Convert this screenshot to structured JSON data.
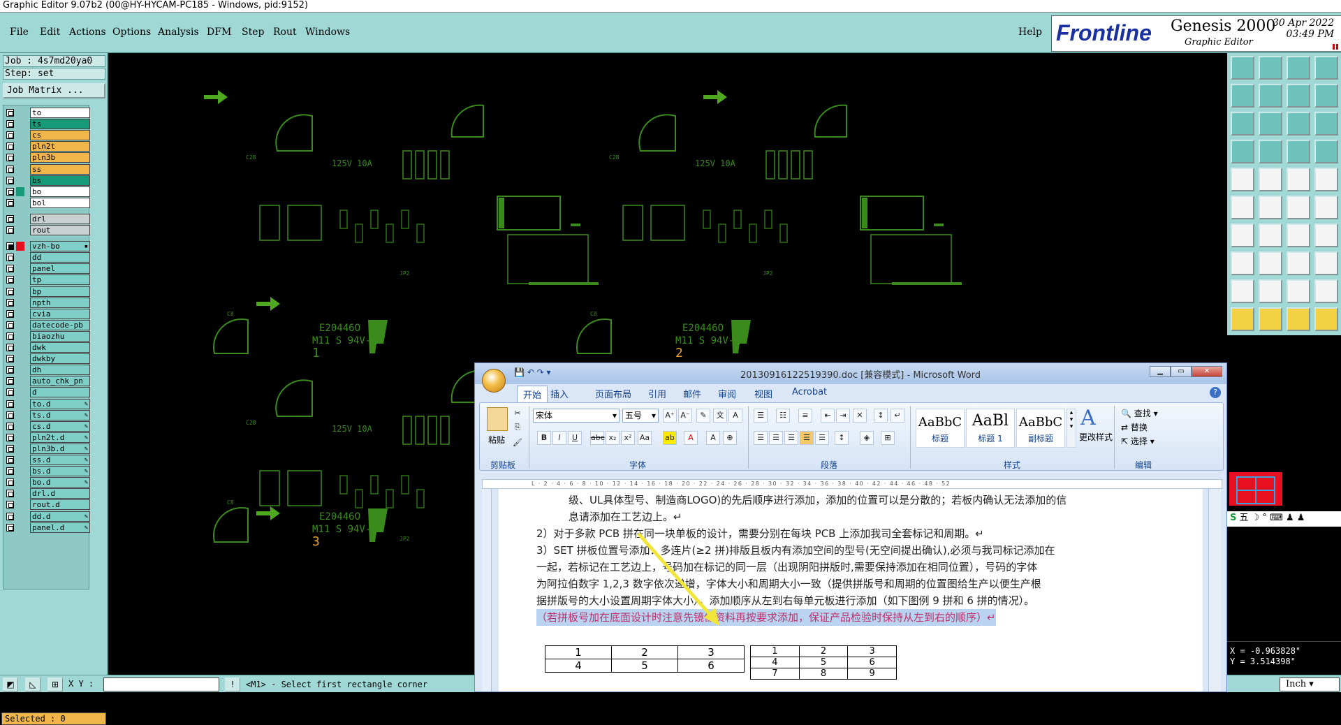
{
  "window": {
    "title": "Graphic Editor 9.07b2 (00@HY-HYCAM-PC185 - Windows, pid:9152)"
  },
  "menu": {
    "items": [
      "File",
      "Edit",
      "Actions",
      "Options",
      "Analysis",
      "DFM",
      "Step",
      "Rout",
      "Windows"
    ],
    "help": "Help"
  },
  "brand": {
    "logo": "Frontline",
    "product": "Genesis 2000",
    "subtitle": "Graphic Editor",
    "date": "30 Apr 2022",
    "time": "03:49 PM"
  },
  "job": {
    "job_label": "Job : 4s7md20ya0",
    "step_label": "Step: set",
    "matrix_button": "Job Matrix ..."
  },
  "layers": [
    {
      "name": "to",
      "color": "w",
      "sel": false
    },
    {
      "name": "ts",
      "color": "g",
      "sel": false
    },
    {
      "name": "cs",
      "color": "o",
      "sel": false
    },
    {
      "name": "pln2t",
      "color": "o",
      "sel": false
    },
    {
      "name": "pln3b",
      "color": "o",
      "sel": false
    },
    {
      "name": "ss",
      "color": "o",
      "sel": false
    },
    {
      "name": "bs",
      "color": "g",
      "sel": false
    },
    {
      "name": "bo",
      "color": "w",
      "sel": false,
      "aff": "#169a78"
    },
    {
      "name": "bol",
      "color": "w",
      "sel": false
    },
    {
      "name": "drl",
      "color": "gr",
      "sel": false
    },
    {
      "name": "rout",
      "color": "gr",
      "sel": false
    },
    {
      "name": "vzh-bo",
      "color": "c",
      "sel": true,
      "aff": "#e81020",
      "mark": "▪"
    },
    {
      "name": "dd",
      "color": "c",
      "sel": false
    },
    {
      "name": "panel",
      "color": "c",
      "sel": false
    },
    {
      "name": "tp",
      "color": "c",
      "sel": false
    },
    {
      "name": "bp",
      "color": "c",
      "sel": false
    },
    {
      "name": "npth",
      "color": "c",
      "sel": false
    },
    {
      "name": "cvia",
      "color": "c",
      "sel": false
    },
    {
      "name": "datecode-pb",
      "color": "c",
      "sel": false
    },
    {
      "name": "biaozhu",
      "color": "c",
      "sel": false
    },
    {
      "name": "dwk",
      "color": "c",
      "sel": false
    },
    {
      "name": "dwkby",
      "color": "c",
      "sel": false
    },
    {
      "name": "dh",
      "color": "c",
      "sel": false
    },
    {
      "name": "auto_chk_pn",
      "color": "c",
      "sel": false
    },
    {
      "name": "d",
      "color": "c",
      "sel": false
    },
    {
      "name": "to.d",
      "color": "c",
      "sel": false,
      "mark": "✎"
    },
    {
      "name": "ts.d",
      "color": "c",
      "sel": false,
      "mark": "✎"
    },
    {
      "name": "cs.d",
      "color": "c",
      "sel": false,
      "mark": "✎"
    },
    {
      "name": "pln2t.d",
      "color": "c",
      "sel": false,
      "mark": "✎"
    },
    {
      "name": "pln3b.d",
      "color": "c",
      "sel": false,
      "mark": "✎"
    },
    {
      "name": "ss.d",
      "color": "c",
      "sel": false,
      "mark": "✎"
    },
    {
      "name": "bs.d",
      "color": "c",
      "sel": false,
      "mark": "✎"
    },
    {
      "name": "bo.d",
      "color": "c",
      "sel": false,
      "mark": "✎"
    },
    {
      "name": "drl.d",
      "color": "c",
      "sel": false
    },
    {
      "name": "rout.d",
      "color": "c",
      "sel": false
    },
    {
      "name": "dd.d",
      "color": "c",
      "sel": false,
      "mark": "✎"
    },
    {
      "name": "panel.d",
      "color": "c",
      "sel": false,
      "mark": "✎"
    }
  ],
  "status": {
    "selected": "Selected : 0",
    "xy_label": "X Y :",
    "xy_value": "",
    "prompt": "<M1> - Select first rectangle corner",
    "units": "Inch",
    "x": "X = -0.963828\"",
    "y": "Y = 3.514398\""
  },
  "canvas": {
    "board_text": [
      "E20446O",
      "M11 S 94V-0",
      "1",
      "2",
      "3"
    ],
    "small": [
      "125V 10A",
      "C28",
      "C8",
      "JP2"
    ]
  },
  "ime": {
    "text": "五 ☽ ° ⌨ ♟ ♟"
  },
  "colors": {
    "cad_green": "#3a8a1c",
    "accent": "#9fd8d4",
    "arrow": "#4ea820"
  },
  "word": {
    "title": "20130916122519390.doc [兼容模式] - Microsoft Word",
    "tabs": [
      "开始",
      "插入",
      "页面布局",
      "引用",
      "邮件",
      "审阅",
      "视图",
      "Acrobat"
    ],
    "font": "宋体",
    "size": "五号",
    "groups": [
      "剪贴板",
      "字体",
      "段落",
      "样式",
      "编辑"
    ],
    "paste": "粘贴",
    "styles": [
      {
        "preview": "AaBbC",
        "name": "标题"
      },
      {
        "preview": "AaBl",
        "name": "标题 1"
      },
      {
        "preview": "AaBbC",
        "name": "副标题"
      }
    ],
    "change_styles": "更改样式",
    "edit": [
      "查找",
      "替换",
      "选择"
    ],
    "ruler": "L · 2 · 4 · 6 · 8 · 10 · 12 · 14 · 16 · 18 · 20 · 22 · 24 · 26 · 28 · 30 · 32 · 34 · 36 · 38 · 40 · 42 · 44 · 46 · 48 · 52",
    "lines": [
      "级、UL具体型号、制造商LOGO)的先后顺序进行添加，添加的位置可以是分散的；若板内确认无法添加的信",
      "息请添加在工艺边上。↵",
      "2）对于多款 PCB 拼在同一块单板的设计，需要分别在每块 PCB 上添加我司全套标记和周期。↵",
      "3）SET 拼板位置号添加：多连片(≥2 拼)排版且板内有添加空间的型号(无空间提出确认),必须与我司标记添加在",
      "一起，若标记在工艺边上，号码加在标记的同一层（出现阴阳拼版时,需要保持添加在相同位置），号码的字体",
      "为阿拉伯数字  1,2,3  数字依次递增，字体大小和周期大小一致（提供拼版号和周期的位置图给生产以便生产根",
      "据拼版号的大小设置周期字体大小），添加顺序从左到右每单元板进行添加（如下图例 9 拼和 6 拼的情况）。",
      "（若拼板号加在底面设计时注意先镜像资料再按要求添加，保证产品检验时保持从左到右的顺序）↵"
    ],
    "table6": [
      [
        "1",
        "2",
        "3"
      ],
      [
        "4",
        "5",
        "6"
      ]
    ],
    "table9": [
      [
        "1",
        "2",
        "3"
      ],
      [
        "4",
        "5",
        "6"
      ],
      [
        "7",
        "8",
        "9"
      ]
    ]
  }
}
